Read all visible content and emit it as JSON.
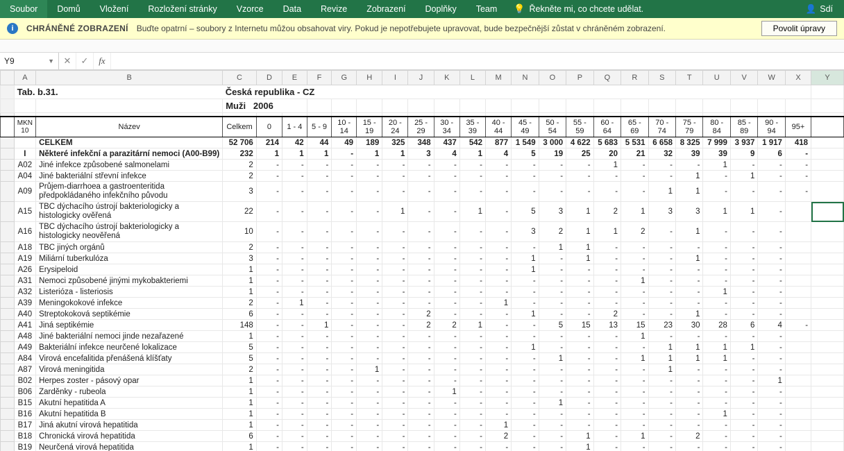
{
  "ribbon": {
    "tabs": [
      "Soubor",
      "Domů",
      "Vložení",
      "Rozložení stránky",
      "Vzorce",
      "Data",
      "Revize",
      "Zobrazení",
      "Doplňky",
      "Team"
    ],
    "tell_me": "Řekněte mi, co chcete udělat.",
    "share": "Sdí"
  },
  "protected_view": {
    "title": "CHRÁNĚNÉ ZOBRAZENÍ",
    "message": "Buďte opatrní – soubory z Internetu můžou obsahovat viry. Pokud je nepotřebujete upravovat, bude bezpečnější zůstat v chráněném zobrazení.",
    "button": "Povolit úpravy"
  },
  "name_box": "Y9",
  "col_letters": [
    "A",
    "B",
    "C",
    "D",
    "E",
    "F",
    "G",
    "H",
    "I",
    "J",
    "K",
    "L",
    "M",
    "N",
    "O",
    "P",
    "Q",
    "R",
    "S",
    "T",
    "U",
    "V",
    "W",
    "X",
    "Y"
  ],
  "title1": "Tab. b.31.",
  "title2": "Česká republika - CZ",
  "title3a": "Muži",
  "title3b": "2006",
  "header": {
    "mkn": "MKN 10",
    "nazev": "Název",
    "celkem": "Celkem",
    "ages": [
      "0",
      "1 - 4",
      "5 - 9",
      "10 - 14",
      "15 - 19",
      "20 - 24",
      "25 - 29",
      "30 - 34",
      "35 - 39",
      "40 - 44",
      "45 - 49",
      "50 - 54",
      "55 - 59",
      "60 - 64",
      "65 - 69",
      "70 - 74",
      "75 - 79",
      "80 - 84",
      "85 - 89",
      "90 - 94",
      "95+"
    ]
  },
  "rows": [
    {
      "code": "",
      "name": "CELKEM",
      "total": "52 706",
      "v": [
        "214",
        "42",
        "44",
        "49",
        "189",
        "325",
        "348",
        "437",
        "542",
        "877",
        "1 549",
        "3 000",
        "4 622",
        "5 683",
        "5 531",
        "6 658",
        "8 325",
        "7 999",
        "3 937",
        "1 917",
        "418"
      ],
      "bold": true
    },
    {
      "code": "I",
      "name": "Některé infekční a parazitární nemoci (A00-B99)",
      "total": "232",
      "v": [
        "1",
        "1",
        "1",
        "-",
        "1",
        "1",
        "3",
        "4",
        "1",
        "4",
        "5",
        "19",
        "25",
        "20",
        "21",
        "32",
        "39",
        "39",
        "9",
        "6",
        "-"
      ],
      "bold": true
    },
    {
      "code": "A02",
      "name": "Jiné infekce způsobené salmonelami",
      "total": "2",
      "v": [
        "-",
        "-",
        "-",
        "-",
        "-",
        "-",
        "-",
        "-",
        "-",
        "-",
        "-",
        "-",
        "-",
        "1",
        "-",
        "-",
        "-",
        "1",
        "-",
        "-",
        "-"
      ]
    },
    {
      "code": "A04",
      "name": "Jiné bakteriální střevní infekce",
      "total": "2",
      "v": [
        "-",
        "-",
        "-",
        "-",
        "-",
        "-",
        "-",
        "-",
        "-",
        "-",
        "-",
        "-",
        "-",
        "-",
        "-",
        "-",
        "1",
        "-",
        "1",
        "-",
        "-"
      ]
    },
    {
      "code": "A09",
      "name": "Průjem-diarrhoea a gastroenteritida předpokládaného infekčního původu",
      "total": "3",
      "v": [
        "-",
        "-",
        "-",
        "-",
        "-",
        "-",
        "-",
        "-",
        "-",
        "-",
        "-",
        "-",
        "-",
        "-",
        "-",
        "1",
        "1",
        "-",
        "-",
        "-",
        "-"
      ],
      "tall": true
    },
    {
      "code": "A15",
      "name": "TBC dýchacího ústrojí bakteriologicky a histologicky ověřená",
      "total": "22",
      "v": [
        "-",
        "-",
        "-",
        "-",
        "-",
        "1",
        "-",
        "-",
        "1",
        "-",
        "5",
        "3",
        "1",
        "2",
        "1",
        "3",
        "3",
        "1",
        "1",
        "-",
        ""
      ],
      "tall": true
    },
    {
      "code": "A16",
      "name": "TBC dýchacího ústrojí bakteriologicky a histologicky neověřená",
      "total": "10",
      "v": [
        "-",
        "-",
        "-",
        "-",
        "-",
        "-",
        "-",
        "-",
        "-",
        "-",
        "3",
        "2",
        "1",
        "1",
        "2",
        "-",
        "1",
        "-",
        "-",
        "-",
        ""
      ],
      "tall": true
    },
    {
      "code": "A18",
      "name": "TBC jiných orgánů",
      "total": "2",
      "v": [
        "-",
        "-",
        "-",
        "-",
        "-",
        "-",
        "-",
        "-",
        "-",
        "-",
        "-",
        "1",
        "1",
        "-",
        "-",
        "-",
        "-",
        "-",
        "-",
        "-",
        ""
      ]
    },
    {
      "code": "A19",
      "name": "Miliární tuberkulóza",
      "total": "3",
      "v": [
        "-",
        "-",
        "-",
        "-",
        "-",
        "-",
        "-",
        "-",
        "-",
        "-",
        "1",
        "-",
        "1",
        "-",
        "-",
        "-",
        "1",
        "-",
        "-",
        "-",
        ""
      ]
    },
    {
      "code": "A26",
      "name": "Erysipeloid",
      "total": "1",
      "v": [
        "-",
        "-",
        "-",
        "-",
        "-",
        "-",
        "-",
        "-",
        "-",
        "-",
        "1",
        "-",
        "-",
        "-",
        "-",
        "-",
        "-",
        "-",
        "-",
        "-",
        ""
      ]
    },
    {
      "code": "A31",
      "name": "Nemoci způsobené jinými mykobakteriemi",
      "total": "1",
      "v": [
        "-",
        "-",
        "-",
        "-",
        "-",
        "-",
        "-",
        "-",
        "-",
        "-",
        "-",
        "-",
        "-",
        "-",
        "1",
        "-",
        "-",
        "-",
        "-",
        "-",
        ""
      ]
    },
    {
      "code": "A32",
      "name": "Listerióza - listeriosis",
      "total": "1",
      "v": [
        "-",
        "-",
        "-",
        "-",
        "-",
        "-",
        "-",
        "-",
        "-",
        "-",
        "-",
        "-",
        "-",
        "-",
        "-",
        "-",
        "-",
        "1",
        "-",
        "-",
        ""
      ]
    },
    {
      "code": "A39",
      "name": "Meningokokové infekce",
      "total": "2",
      "v": [
        "-",
        "1",
        "-",
        "-",
        "-",
        "-",
        "-",
        "-",
        "-",
        "1",
        "-",
        "-",
        "-",
        "-",
        "-",
        "-",
        "-",
        "-",
        "-",
        "-",
        ""
      ]
    },
    {
      "code": "A40",
      "name": "Streptokoková septikémie",
      "total": "6",
      "v": [
        "-",
        "-",
        "-",
        "-",
        "-",
        "-",
        "2",
        "-",
        "-",
        "-",
        "1",
        "-",
        "-",
        "2",
        "-",
        "-",
        "1",
        "-",
        "-",
        "-",
        ""
      ]
    },
    {
      "code": "A41",
      "name": "Jiná septikémie",
      "total": "148",
      "v": [
        "-",
        "-",
        "1",
        "-",
        "-",
        "-",
        "2",
        "2",
        "1",
        "-",
        "-",
        "5",
        "15",
        "13",
        "15",
        "23",
        "30",
        "28",
        "6",
        "4",
        "-"
      ]
    },
    {
      "code": "A48",
      "name": "Jiné bakteriální nemoci jinde nezařazené",
      "total": "1",
      "v": [
        "-",
        "-",
        "-",
        "-",
        "-",
        "-",
        "-",
        "-",
        "-",
        "-",
        "-",
        "-",
        "-",
        "-",
        "1",
        "-",
        "-",
        "-",
        "-",
        "-",
        ""
      ]
    },
    {
      "code": "A49",
      "name": "Bakteriální infekce neurčené lokalizace",
      "total": "5",
      "v": [
        "-",
        "-",
        "-",
        "-",
        "-",
        "-",
        "-",
        "-",
        "-",
        "-",
        "1",
        "-",
        "-",
        "-",
        "-",
        "1",
        "1",
        "1",
        "1",
        "-",
        ""
      ]
    },
    {
      "code": "A84",
      "name": "Virová encefalitida přenášená klíšťaty",
      "total": "5",
      "v": [
        "-",
        "-",
        "-",
        "-",
        "-",
        "-",
        "-",
        "-",
        "-",
        "-",
        "-",
        "1",
        "-",
        "-",
        "1",
        "1",
        "1",
        "1",
        "-",
        "-",
        ""
      ]
    },
    {
      "code": "A87",
      "name": "Virová meningitida",
      "total": "2",
      "v": [
        "-",
        "-",
        "-",
        "-",
        "1",
        "-",
        "-",
        "-",
        "-",
        "-",
        "-",
        "-",
        "-",
        "-",
        "-",
        "1",
        "-",
        "-",
        "-",
        "-",
        ""
      ]
    },
    {
      "code": "B02",
      "name": "Herpes zoster - pásový opar",
      "total": "1",
      "v": [
        "-",
        "-",
        "-",
        "-",
        "-",
        "-",
        "-",
        "-",
        "-",
        "-",
        "-",
        "-",
        "-",
        "-",
        "-",
        "-",
        "-",
        "-",
        "-",
        "1",
        ""
      ]
    },
    {
      "code": "B06",
      "name": "Zarděnky - rubeola",
      "total": "1",
      "v": [
        "-",
        "-",
        "-",
        "-",
        "-",
        "-",
        "-",
        "1",
        "-",
        "-",
        "-",
        "-",
        "-",
        "-",
        "-",
        "-",
        "-",
        "-",
        "-",
        "-",
        ""
      ]
    },
    {
      "code": "B15",
      "name": "Akutní hepatitida A",
      "total": "1",
      "v": [
        "-",
        "-",
        "-",
        "-",
        "-",
        "-",
        "-",
        "-",
        "-",
        "-",
        "-",
        "1",
        "-",
        "-",
        "-",
        "-",
        "-",
        "-",
        "-",
        "-",
        ""
      ]
    },
    {
      "code": "B16",
      "name": "Akutní hepatitida B",
      "total": "1",
      "v": [
        "-",
        "-",
        "-",
        "-",
        "-",
        "-",
        "-",
        "-",
        "-",
        "-",
        "-",
        "-",
        "-",
        "-",
        "-",
        "-",
        "-",
        "1",
        "-",
        "-",
        ""
      ]
    },
    {
      "code": "B17",
      "name": "Jiná akutní virová hepatitida",
      "total": "1",
      "v": [
        "-",
        "-",
        "-",
        "-",
        "-",
        "-",
        "-",
        "-",
        "-",
        "1",
        "-",
        "-",
        "-",
        "-",
        "-",
        "-",
        "-",
        "-",
        "-",
        "-",
        ""
      ]
    },
    {
      "code": "B18",
      "name": "Chronická virová hepatitida",
      "total": "6",
      "v": [
        "-",
        "-",
        "-",
        "-",
        "-",
        "-",
        "-",
        "-",
        "-",
        "2",
        "-",
        "-",
        "1",
        "-",
        "1",
        "-",
        "2",
        "-",
        "-",
        "-",
        ""
      ]
    },
    {
      "code": "B19",
      "name": "Neurčená virová hepatitida",
      "total": "1",
      "v": [
        "-",
        "-",
        "-",
        "-",
        "-",
        "-",
        "-",
        "-",
        "-",
        "-",
        "-",
        "-",
        "1",
        "-",
        "-",
        "-",
        "-",
        "-",
        "-",
        "-",
        ""
      ]
    }
  ]
}
